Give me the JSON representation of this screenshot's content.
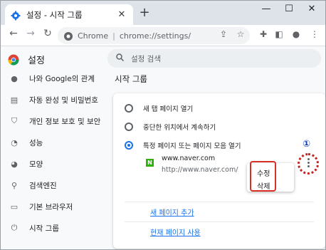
{
  "window": {
    "tab_title": "설정 - 시작 그룹",
    "tab_close": "✕",
    "new_tab": "+",
    "minimize": "—",
    "maximize": "☐",
    "close": "✕"
  },
  "toolbar": {
    "back": "←",
    "forward": "→",
    "reload": "↻",
    "omnibox_chrome": "Chrome",
    "omnibox_sep": "|",
    "omnibox_url": "chrome://settings/",
    "share": "⇪",
    "bookmark": "☆",
    "extensions": "✚",
    "sidepanel": "◧",
    "profile": "●",
    "menu": "⋮"
  },
  "header": {
    "title": "설정",
    "search_placeholder": "설정 검색"
  },
  "sidebar": {
    "items": [
      {
        "label": "나와 Google의 관계",
        "icon": "person-icon",
        "glyph": "●"
      },
      {
        "label": "자동 완성 및 비밀번호",
        "icon": "clipboard-icon",
        "glyph": "▤"
      },
      {
        "label": "개인 정보 보호 및 보안",
        "icon": "shield-icon",
        "glyph": "⛉"
      },
      {
        "label": "성능",
        "icon": "gauge-icon",
        "glyph": "◔"
      },
      {
        "label": "모양",
        "icon": "palette-icon",
        "glyph": "◕"
      },
      {
        "label": "검색엔진",
        "icon": "search-icon",
        "glyph": "⚲"
      },
      {
        "label": "기본 브라우저",
        "icon": "browser-icon",
        "glyph": "▭"
      },
      {
        "label": "시작 그룹",
        "icon": "power-icon",
        "glyph": "⏻"
      }
    ]
  },
  "main": {
    "section_title": "시작 그룹",
    "options": [
      {
        "label": "새 탭 페이지 열기",
        "selected": false
      },
      {
        "label": "중단한 위치에서 계속하기",
        "selected": false
      },
      {
        "label": "특정 페이지 또는 페이지 모음 열기",
        "selected": true
      }
    ],
    "site": {
      "favicon": "N",
      "name": "www.naver.com",
      "url": "http://www.naver.com/"
    },
    "context_menu": {
      "edit": "수정",
      "delete": "삭제"
    },
    "callout_number": "①",
    "add_page_link": "새 페이지 추가",
    "use_current_link": "현재 페이지 사용"
  },
  "colors": {
    "accent": "#1a73e8",
    "callout_red": "#d93025",
    "naver_green": "#2db400"
  }
}
